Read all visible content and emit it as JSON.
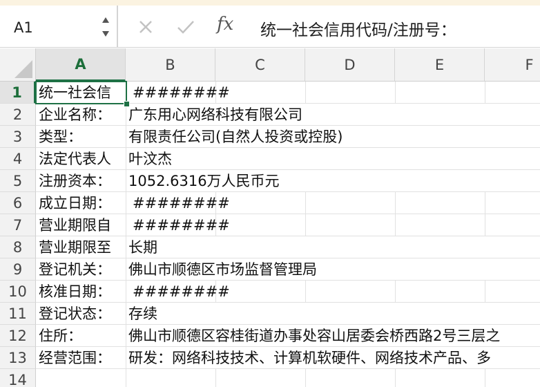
{
  "name_box": {
    "ref": "A1"
  },
  "formula_bar": {
    "fx_label": "fx",
    "content": "统一社会信用代码/注册号："
  },
  "columns": [
    "A",
    "B",
    "C",
    "D",
    "E",
    "F"
  ],
  "rows": [
    {
      "num": "1",
      "a": "统一社会信",
      "b": "########"
    },
    {
      "num": "2",
      "a": "企业名称：",
      "b": "广东用心网络科技有限公司"
    },
    {
      "num": "3",
      "a": "类型：",
      "b": "有限责任公司(自然人投资或控股)"
    },
    {
      "num": "4",
      "a": "法定代表人",
      "b": "叶汶杰"
    },
    {
      "num": "5",
      "a": "注册资本：",
      "b": "1052.6316万人民币元"
    },
    {
      "num": "6",
      "a": "成立日期：",
      "b": "########"
    },
    {
      "num": "7",
      "a": "营业期限自",
      "b": "########"
    },
    {
      "num": "8",
      "a": "营业期限至",
      "b": "长期"
    },
    {
      "num": "9",
      "a": "登记机关：",
      "b": "佛山市顺德区市场监督管理局"
    },
    {
      "num": "10",
      "a": "核准日期：",
      "b": "########"
    },
    {
      "num": "11",
      "a": "登记状态：",
      "b": "存续"
    },
    {
      "num": "12",
      "a": "住所：",
      "b": "佛山市顺德区容桂街道办事处容山居委会桥西路2号三层之"
    },
    {
      "num": "13",
      "a": "经营范围：",
      "b": "研发：网络科技技术、计算机软硬件、网络技术产品、多"
    },
    {
      "num": "14",
      "a": "",
      "b": ""
    }
  ],
  "selected_cell": {
    "column": "A",
    "row": "1"
  },
  "colors": {
    "accent": "#1e7145",
    "header_bg": "#f2f2f2",
    "grid_line": "#e1e1e1"
  },
  "icons": [
    "stepper-icon",
    "cancel-x-icon",
    "confirm-check-icon",
    "fx-icon"
  ]
}
